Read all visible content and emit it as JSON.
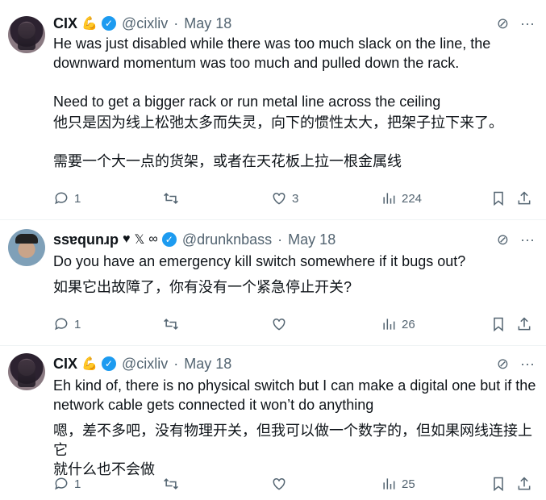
{
  "tweets": [
    {
      "author_name": "CIX",
      "author_handle": "@cixliv",
      "date": "May 18",
      "lines": [
        "He was just disabled while there was too much slack on the line, the",
        "downward momentum was too much and pulled down the rack.",
        "",
        "Need to get a bigger rack or run metal line across the ceiling",
        "他只是因为线上松弛太多而失灵，向下的惯性太大，把架子拉下来了。",
        "",
        "需要一个大一点的货架，或者在天花板上拉一根金属线"
      ],
      "replies": "1",
      "retweets": "",
      "likes": "3",
      "views": "224"
    },
    {
      "author_name": "ssɐqunɹp",
      "author_handle": "@drunknbass",
      "date": "May 18",
      "lines": [
        "Do you have an emergency kill switch somewhere if it bugs out?",
        "如果它出故障了，你有没有一个紧急停止开关?"
      ],
      "replies": "1",
      "retweets": "",
      "likes": "",
      "views": "26"
    },
    {
      "author_name": "CIX",
      "author_handle": "@cixliv",
      "date": "May 18",
      "lines": [
        "Eh kind of, there is no physical switch but I can make a digital one but if the",
        "network cable gets connected it won’t do anything",
        "嗯，差不多吧，没有物理开关，但我可以做一个数字的，但如果网线连接上它",
        "就什么也不会做"
      ],
      "replies": "1",
      "retweets": "",
      "likes": "",
      "views": "25"
    }
  ],
  "icons": {
    "reply": "reply-icon",
    "retweet": "retweet-icon",
    "like": "heart-icon",
    "views": "views-icon",
    "bookmark": "bookmark-icon",
    "share": "share-icon",
    "grok": "grok-icon",
    "more": "more-icon"
  },
  "colors": {
    "verified": "#1d9bf0",
    "muted": "#536471",
    "text": "#0f1419"
  }
}
